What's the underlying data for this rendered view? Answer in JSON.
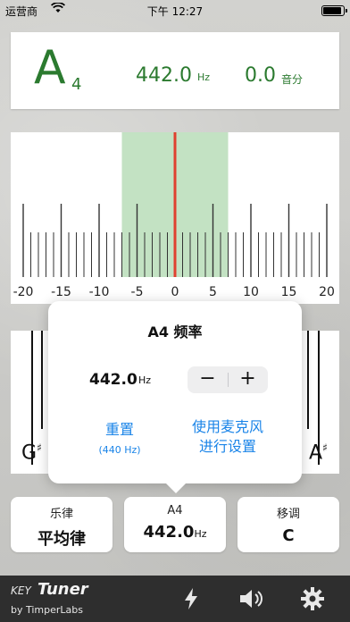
{
  "status_bar": {
    "carrier": "运营商",
    "time": "下午 12:27"
  },
  "readout": {
    "note_letter": "A",
    "note_octave": "4",
    "frequency": "442.0",
    "frequency_unit": "Hz",
    "cents": "0.0",
    "cents_unit": "音分"
  },
  "meter": {
    "scale_labels": [
      "-20",
      "-15",
      "-10",
      "-5",
      "0",
      "5",
      "10",
      "15",
      "20"
    ],
    "needle_cents": 0,
    "in_tune_range": [
      -7,
      7
    ],
    "colors": {
      "in_tune_band": "#c3e2c3",
      "needle": "#e04030"
    }
  },
  "keyboard": {
    "left_key_label": "G",
    "right_key_label": "A",
    "sharp_symbol": "♯"
  },
  "popover": {
    "title": "A4 频率",
    "frequency": "442.0",
    "frequency_unit": "Hz",
    "minus_label": "−",
    "plus_label": "+",
    "reset_label": "重置",
    "reset_sub": "(440 Hz)",
    "mic_label_line1": "使用麦克风",
    "mic_label_line2": "进行设置"
  },
  "bottom_buttons": {
    "temperament": {
      "label": "乐律",
      "value": "平均律"
    },
    "a4": {
      "label": "A4",
      "value": "442.0",
      "unit": "Hz"
    },
    "transpose": {
      "label": "移调",
      "value": "C"
    }
  },
  "toolbar": {
    "brand_key": "KEY",
    "brand_tuner": "Tuner",
    "brand_sub": "by TimperLabs",
    "icons": [
      "lightning-icon",
      "speaker-icon",
      "gear-icon"
    ]
  },
  "colors": {
    "accent_green": "#2b7a2f",
    "link_blue": "#1a84e8",
    "toolbar_bg": "#2e2e2e"
  }
}
